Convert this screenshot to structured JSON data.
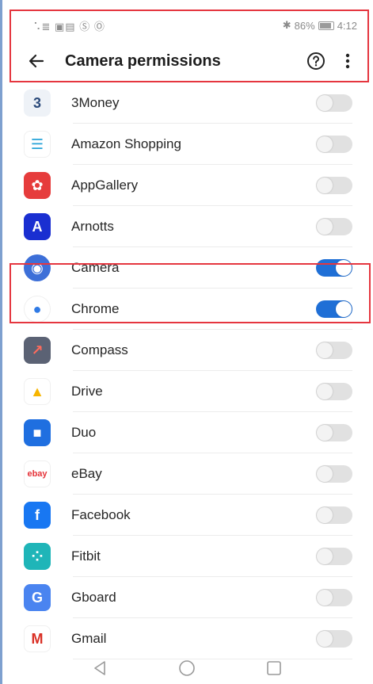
{
  "status": {
    "left_icons_text": "⠡≣ ▣▤ Ⓢ Ⓞ",
    "bluetooth_glyph": "✱",
    "battery_percent": "86%",
    "time": "4:12"
  },
  "appbar": {
    "title": "Camera permissions",
    "back_icon": "arrow-left-icon",
    "help_icon": "help-circle-icon",
    "more_icon": "more-vertical-icon"
  },
  "apps": [
    {
      "name": "3Money",
      "enabled": false,
      "icon": "3money-icon",
      "glyph": "3",
      "color": "#eef2f7",
      "glyph_color": "#2b4a7a"
    },
    {
      "name": "Amazon Shopping",
      "enabled": false,
      "icon": "amazon-icon",
      "glyph": "☰",
      "color": "#ffffff",
      "glyph_color": "#26a3d8"
    },
    {
      "name": "AppGallery",
      "enabled": false,
      "icon": "appgallery-icon",
      "glyph": "✿",
      "color": "#e63c3c",
      "glyph_color": "#ffffff"
    },
    {
      "name": "Arnotts",
      "enabled": false,
      "icon": "arnotts-icon",
      "glyph": "A",
      "color": "#1a2fd1",
      "glyph_color": "#ffffff"
    },
    {
      "name": "Camera",
      "enabled": true,
      "icon": "camera-app-icon",
      "glyph": "◉",
      "color": "#3d6fd8",
      "glyph_color": "#ffffff"
    },
    {
      "name": "Chrome",
      "enabled": true,
      "icon": "chrome-icon",
      "glyph": "●",
      "color": "#ffffff",
      "glyph_color": "#2f7ae5"
    },
    {
      "name": "Compass",
      "enabled": false,
      "icon": "compass-icon",
      "glyph": "↗",
      "color": "#5b6274",
      "glyph_color": "#ff6b5c"
    },
    {
      "name": "Drive",
      "enabled": false,
      "icon": "drive-icon",
      "glyph": "▲",
      "color": "#ffffff",
      "glyph_color": "#f7b500"
    },
    {
      "name": "Duo",
      "enabled": false,
      "icon": "duo-icon",
      "glyph": "■",
      "color": "#1f6fe0",
      "glyph_color": "#ffffff"
    },
    {
      "name": "eBay",
      "enabled": false,
      "icon": "ebay-icon",
      "glyph": "ebay",
      "color": "#ffffff",
      "glyph_color": "#e53238"
    },
    {
      "name": "Facebook",
      "enabled": false,
      "icon": "facebook-icon",
      "glyph": "f",
      "color": "#1877f2",
      "glyph_color": "#ffffff"
    },
    {
      "name": "Fitbit",
      "enabled": false,
      "icon": "fitbit-icon",
      "glyph": "⁘",
      "color": "#1fb5b8",
      "glyph_color": "#ffffff"
    },
    {
      "name": "Gboard",
      "enabled": false,
      "icon": "gboard-icon",
      "glyph": "G",
      "color": "#4a84f0",
      "glyph_color": "#ffffff"
    },
    {
      "name": "Gmail",
      "enabled": false,
      "icon": "gmail-icon",
      "glyph": "M",
      "color": "#ffffff",
      "glyph_color": "#d93025"
    }
  ],
  "navbar": {
    "back_icon": "nav-back-triangle-icon",
    "home_icon": "nav-home-circle-icon",
    "recents_icon": "nav-recents-square-icon"
  },
  "colors": {
    "toggle_on": "#1f6fd6",
    "toggle_off": "#e1e1e1",
    "highlight_border": "#e5363f"
  }
}
